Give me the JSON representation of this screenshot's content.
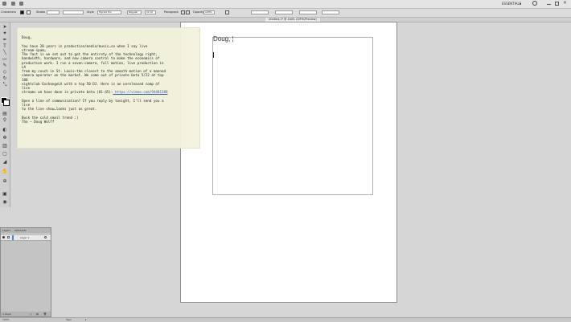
{
  "menubar": {
    "workspace_label": "ESSENTIALS",
    "workspace_arrow": "▾",
    "account": "",
    "close_glyph": "✕"
  },
  "controlbar": {
    "label_characters": "Characters",
    "font_name": "Myriad Pro",
    "font_style": "Regular",
    "font_size": "12 pt",
    "label_paragraph": "Paragraph",
    "label_opacity": "Opacity",
    "opacity_value": "100%",
    "label_stroke": "Stroke",
    "label_style": "Style",
    "x_value": "",
    "y_value": "",
    "w_value": "",
    "h_value": ""
  },
  "document": {
    "tab_label": "Untitled-1* @ 100% (CMYK/Preview)"
  },
  "artboard": {
    "frame_text": "Doug, ¦"
  },
  "note": {
    "lines": [
      "Doug,",
      "",
      "You have 20 years in production/media/music…so when I say live",
      "stream-spam…",
      "The fact is we set out to get the entirety of the technology right,",
      "bandwidth, hardware, and now camera control to make the economics of",
      "production work. I run a seven-camera, full motion, live production in",
      "LA",
      "from my couch in St. Louis—the closest to the smooth motion of a manned",
      "camera operator on the market. We come out of private beta 5/22 at top",
      "100",
      "nightclub ExchangeLA with a top 50 DJ. Here is an unreleased comp of",
      "live",
      "streams we have done in private beta (01:45):",
      "",
      "Open a line of communication? If you reply by tonight, I'll send you a",
      "live",
      "to the live show…looks just as great.",
      "",
      "Buck the cold email trend :)",
      "Tho – Doug Wolff"
    ],
    "link_text": "https://vimeo.com/94481388"
  },
  "layers": {
    "tab_layers": "Layers",
    "tab_artboards": "Artboards",
    "layer_name": "Layer 1",
    "footer_label": "1 Layer"
  },
  "status": {
    "zoom": "100%",
    "tool_name": "Type"
  },
  "colors": {
    "note_bg": "#f2f2dc",
    "link": "#3b5aa8",
    "layer_color": "#4f7fd7"
  }
}
